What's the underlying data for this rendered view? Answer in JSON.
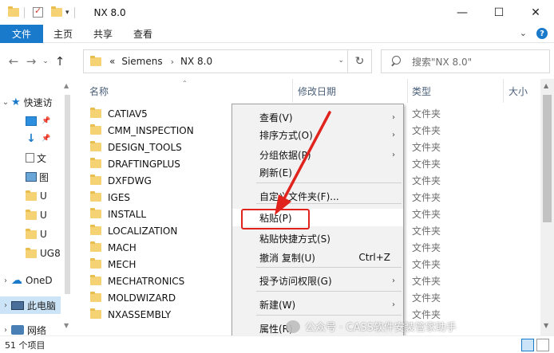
{
  "window": {
    "title": "NX 8.0",
    "min_glyph": "—",
    "max_glyph": "☐",
    "close_glyph": "✕"
  },
  "ribbon": {
    "file_tab": "文件",
    "tabs": [
      "主页",
      "共享",
      "查看"
    ]
  },
  "address_bar": {
    "prefix": "«",
    "crumbs": [
      "Siemens",
      "NX 8.0"
    ],
    "search_placeholder": "搜索\"NX 8.0\""
  },
  "columns": {
    "name": "名称",
    "modified": "修改日期",
    "type": "类型",
    "size": "大小"
  },
  "sidebar": {
    "quick_access": "快速访",
    "items": [
      "",
      "",
      "文",
      "图",
      "U",
      "U",
      "U",
      "UG8"
    ],
    "onedrive": "OneD",
    "this_pc": "此电脑",
    "network": "网络"
  },
  "files": [
    {
      "name": "CATIAV5",
      "type": "文件夹"
    },
    {
      "name": "CMM_INSPECTION",
      "type": "文件夹"
    },
    {
      "name": "DESIGN_TOOLS",
      "type": "文件夹"
    },
    {
      "name": "DRAFTINGPLUS",
      "type": "文件夹"
    },
    {
      "name": "DXFDWG",
      "type": "文件夹"
    },
    {
      "name": "IGES",
      "type": "文件夹"
    },
    {
      "name": "INSTALL",
      "type": "文件夹"
    },
    {
      "name": "LOCALIZATION",
      "type": "文件夹"
    },
    {
      "name": "MACH",
      "type": "文件夹"
    },
    {
      "name": "MECH",
      "type": "文件夹"
    },
    {
      "name": "MECHATRONICS",
      "type": "文件夹"
    },
    {
      "name": "MOLDWIZARD",
      "type": "文件夹"
    },
    {
      "name": "NXASSEMBLY",
      "type": "文件夹"
    }
  ],
  "context_menu": {
    "items": [
      {
        "label": "查看(V)",
        "submenu": true
      },
      {
        "label": "排序方式(O)",
        "submenu": true
      },
      {
        "label": "分组依据(P)",
        "submenu": true
      },
      {
        "label": "刷新(E)"
      },
      {
        "label": "自定义文件夹(F)..."
      },
      {
        "label": "粘贴(P)",
        "highlighted": true
      },
      {
        "label": "粘贴快捷方式(S)"
      },
      {
        "label": "撤消 复制(U)",
        "shortcut": "Ctrl+Z"
      },
      {
        "label": "授予访问权限(G)",
        "submenu": true
      },
      {
        "label": "新建(W)",
        "submenu": true
      },
      {
        "label": "属性(R)"
      }
    ]
  },
  "status": {
    "item_count": "51 个项目"
  },
  "watermark": "公众号 · CASS软件安装管家助手",
  "colors": {
    "accent": "#1979ca",
    "annotation_red": "#e0231d",
    "folder_yellow": "#f5d274"
  }
}
